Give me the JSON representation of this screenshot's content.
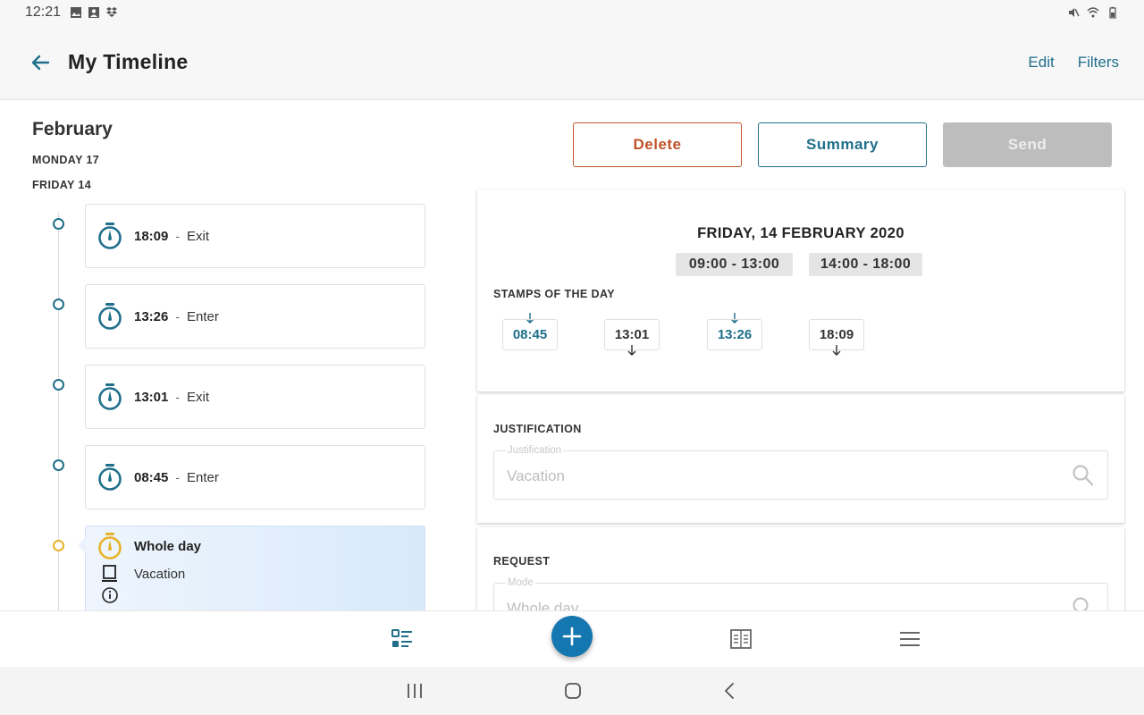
{
  "status_bar": {
    "time": "12:21"
  },
  "header": {
    "title": "My Timeline",
    "edit_label": "Edit",
    "filters_label": "Filters"
  },
  "timeline": {
    "month": "February",
    "days": [
      "MONDAY 17",
      "FRIDAY 14"
    ],
    "entries": [
      {
        "time": "18:09",
        "kind": "Exit"
      },
      {
        "time": "13:26",
        "kind": "Enter"
      },
      {
        "time": "13:01",
        "kind": "Exit"
      },
      {
        "time": "08:45",
        "kind": "Enter"
      }
    ],
    "selected": {
      "title": "Whole day",
      "subtitle": "Vacation"
    }
  },
  "actions": {
    "delete_label": "Delete",
    "summary_label": "Summary",
    "send_label": "Send"
  },
  "detail": {
    "date": "FRIDAY, 14 FEBRUARY 2020",
    "shifts": [
      "09:00 - 13:00",
      "14:00 - 18:00"
    ],
    "stamps_label": "STAMPS OF THE DAY",
    "stamps": [
      {
        "time": "08:45",
        "direction": "in"
      },
      {
        "time": "13:01",
        "direction": "out"
      },
      {
        "time": "13:26",
        "direction": "in"
      },
      {
        "time": "18:09",
        "direction": "out"
      }
    ]
  },
  "justification": {
    "section_label": "JUSTIFICATION",
    "field_label": "Justification",
    "value": "Vacation"
  },
  "request": {
    "section_label": "REQUEST",
    "field_label": "Mode",
    "value": "Whole day"
  },
  "colors": {
    "accent": "#1f6f8b",
    "delete": "#c0532a",
    "fab": "#1577b0",
    "selected_dot": "#e8b22a"
  },
  "icons": {
    "back": "arrow-left-icon",
    "timer": "stopwatch-icon",
    "search": "search-icon",
    "nav": [
      "timeline-list-icon",
      "add-icon",
      "calendar-grid-icon",
      "menu-icon"
    ]
  }
}
